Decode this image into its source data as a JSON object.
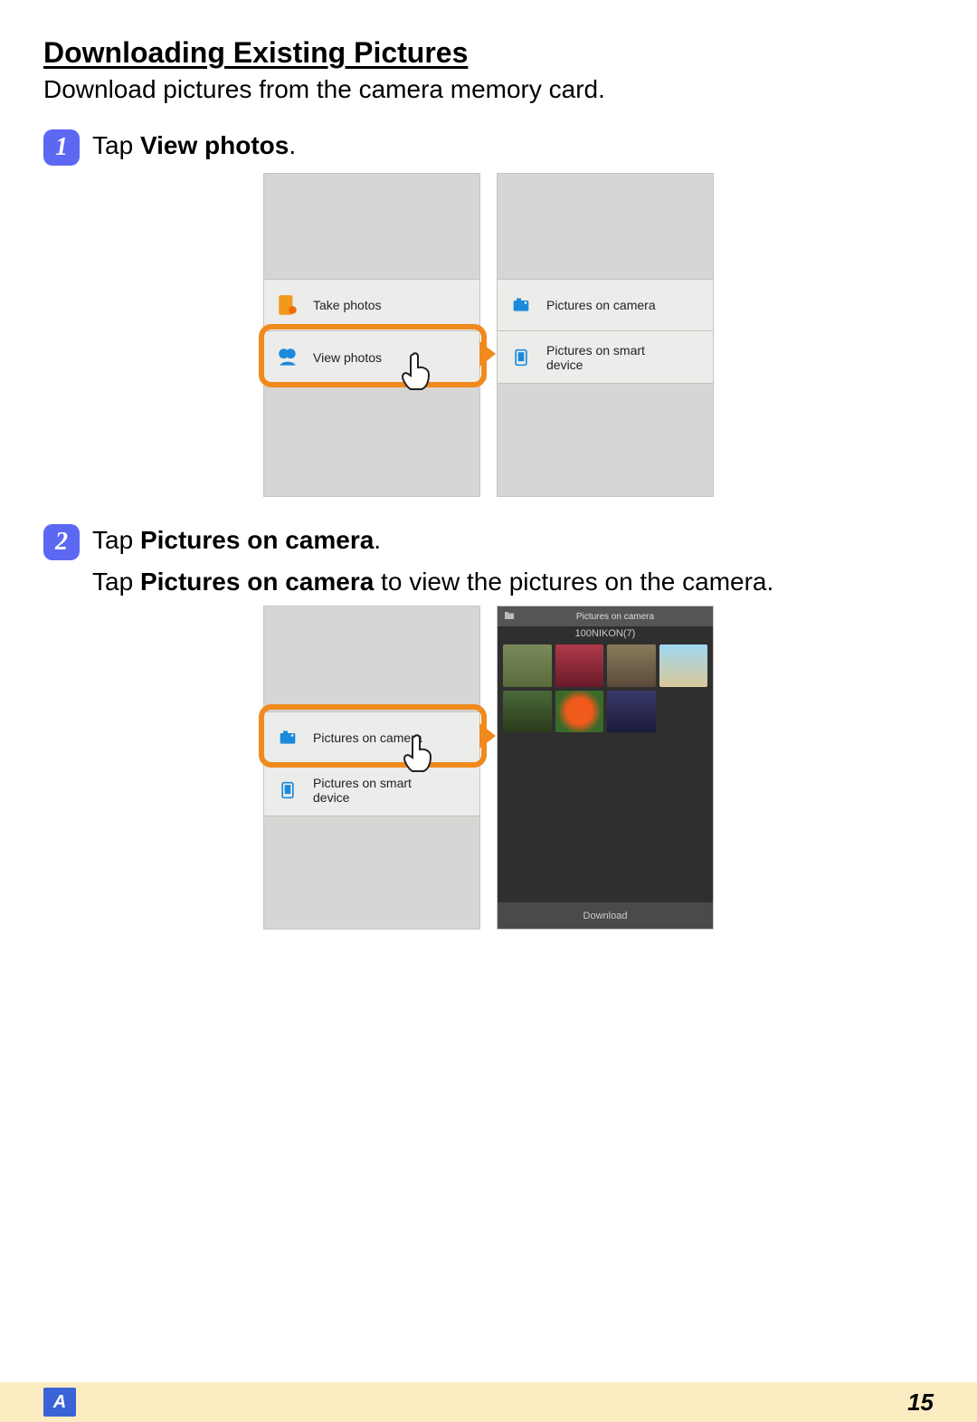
{
  "title": "Downloading Existing Pictures",
  "subtitle": "Download pictures from the camera memory card.",
  "steps": [
    {
      "num": "1",
      "line_pre": "Tap ",
      "line_bold": "View photos",
      "line_post": "."
    },
    {
      "num": "2",
      "line_pre": "Tap ",
      "line_bold": "Pictures on camera",
      "line_post": ".",
      "desc_pre": "Tap ",
      "desc_bold": "Pictures on camera",
      "desc_post": " to view the pictures on the camera."
    }
  ],
  "menu1": {
    "take_photos": "Take photos",
    "view_photos": "View photos"
  },
  "menu2": {
    "pics_camera": "Pictures on camera",
    "pics_device_l1": "Pictures on smart",
    "pics_device_l2": "device"
  },
  "gallery": {
    "header": "Pictures on camera",
    "folder": "100NIKON(7)",
    "download": "Download",
    "thumbs": [
      "#8a7a4a",
      "#8c2a3a",
      "#6a614a",
      "#9fcfe6",
      "#394a36",
      "#e07a1a",
      "#2a2a4a"
    ]
  },
  "footer": {
    "section": "A",
    "page": "15"
  }
}
